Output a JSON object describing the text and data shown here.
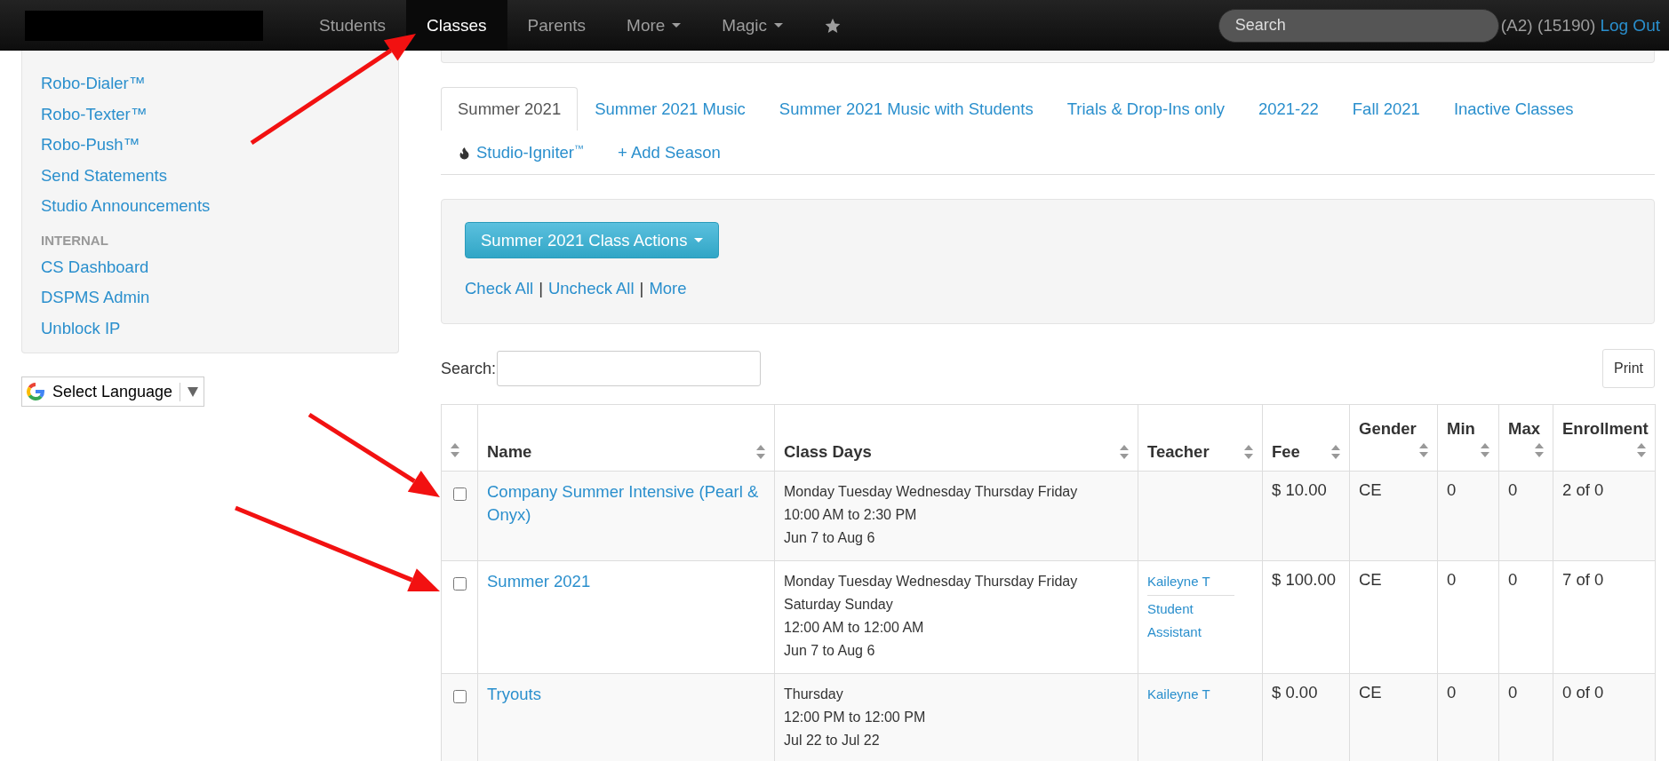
{
  "navbar": {
    "items": [
      {
        "label": "Students",
        "selected": false,
        "dropdown": false
      },
      {
        "label": "Classes",
        "selected": true,
        "dropdown": false
      },
      {
        "label": "Parents",
        "selected": false,
        "dropdown": false
      },
      {
        "label": "More",
        "selected": false,
        "dropdown": true
      },
      {
        "label": "Magic",
        "selected": false,
        "dropdown": true
      }
    ],
    "search": {
      "placeholder": "Search"
    },
    "account": "(A2) (15190)",
    "logout": "Log Out"
  },
  "sidebar": {
    "items": [
      {
        "kind": "link",
        "label": "Robo-Dialer™"
      },
      {
        "kind": "link",
        "label": "Robo-Texter™"
      },
      {
        "kind": "link",
        "label": "Robo-Push™"
      },
      {
        "kind": "link",
        "label": "Send Statements"
      },
      {
        "kind": "link",
        "label": "Studio Announcements"
      },
      {
        "kind": "header",
        "label": "INTERNAL"
      },
      {
        "kind": "link",
        "label": "CS Dashboard"
      },
      {
        "kind": "link",
        "label": "DSPMS Admin"
      },
      {
        "kind": "link",
        "label": "Unblock IP"
      }
    ]
  },
  "language_selector": {
    "label": "Select Language"
  },
  "season_tabs": [
    {
      "kind": "tab",
      "label": "Summer 2021",
      "selected": true
    },
    {
      "kind": "tab",
      "label": "Summer 2021 Music",
      "selected": false
    },
    {
      "kind": "tab",
      "label": "Summer 2021 Music with Students",
      "selected": false
    },
    {
      "kind": "tab",
      "label": "Trials & Drop-Ins only",
      "selected": false
    },
    {
      "kind": "tab",
      "label": "2021-22",
      "selected": false
    },
    {
      "kind": "tab",
      "label": "Fall 2021",
      "selected": false
    },
    {
      "kind": "tab",
      "label": "Inactive Classes",
      "selected": false
    },
    {
      "kind": "igniter",
      "label": "Studio-Igniter$^{™}$",
      "selected": false
    },
    {
      "kind": "add",
      "label": "+ Add Season",
      "selected": false
    }
  ],
  "actions": {
    "button": "Summer 2021 Class Actions",
    "links": [
      "Check All",
      "Uncheck All",
      "More"
    ],
    "separator": "|"
  },
  "table_search": {
    "label": "Search:"
  },
  "print": "Print",
  "table": {
    "columns": [
      {
        "label": "Name",
        "kind": "inline"
      },
      {
        "label": "Class Days",
        "kind": "inline"
      },
      {
        "label": "Teacher",
        "kind": "inline"
      },
      {
        "label": "Fee",
        "kind": "inline"
      },
      {
        "label": "Gender",
        "kind": "stacked"
      },
      {
        "label": "Min",
        "kind": "stacked"
      },
      {
        "label": "Max",
        "kind": "stacked"
      },
      {
        "label": "Enrollment",
        "kind": "stacked"
      }
    ],
    "rows": [
      {
        "checked": false,
        "name": "Company Summer Intensive (Pearl & Onyx)",
        "days": [
          "Monday Tuesday Wednesday Thursday Friday",
          "10:00 AM to 2:30 PM",
          "Jun 7 to Aug 6"
        ],
        "teachers": [],
        "fee": "$ 10.00",
        "gender": "CE",
        "min": "0",
        "max": "0",
        "enrollment": "2 of 0"
      },
      {
        "checked": false,
        "name": "Summer 2021",
        "days": [
          "Monday Tuesday Wednesday Thursday Friday",
          "Saturday Sunday",
          "12:00 AM to 12:00 AM",
          "Jun 7 to Aug 6"
        ],
        "teachers": [
          "Kaileyne T",
          "Student Assistant"
        ],
        "fee": "$ 100.00",
        "gender": "CE",
        "min": "0",
        "max": "0",
        "enrollment": "7 of 0"
      },
      {
        "checked": false,
        "name": "Tryouts",
        "days": [
          "Thursday",
          "12:00 PM to 12:00 PM",
          "Jul 22 to Jul 22"
        ],
        "teachers": [
          "Kaileyne T"
        ],
        "fee": "$ 0.00",
        "gender": "CE",
        "min": "0",
        "max": "0",
        "enrollment": "0 of 0"
      }
    ]
  }
}
